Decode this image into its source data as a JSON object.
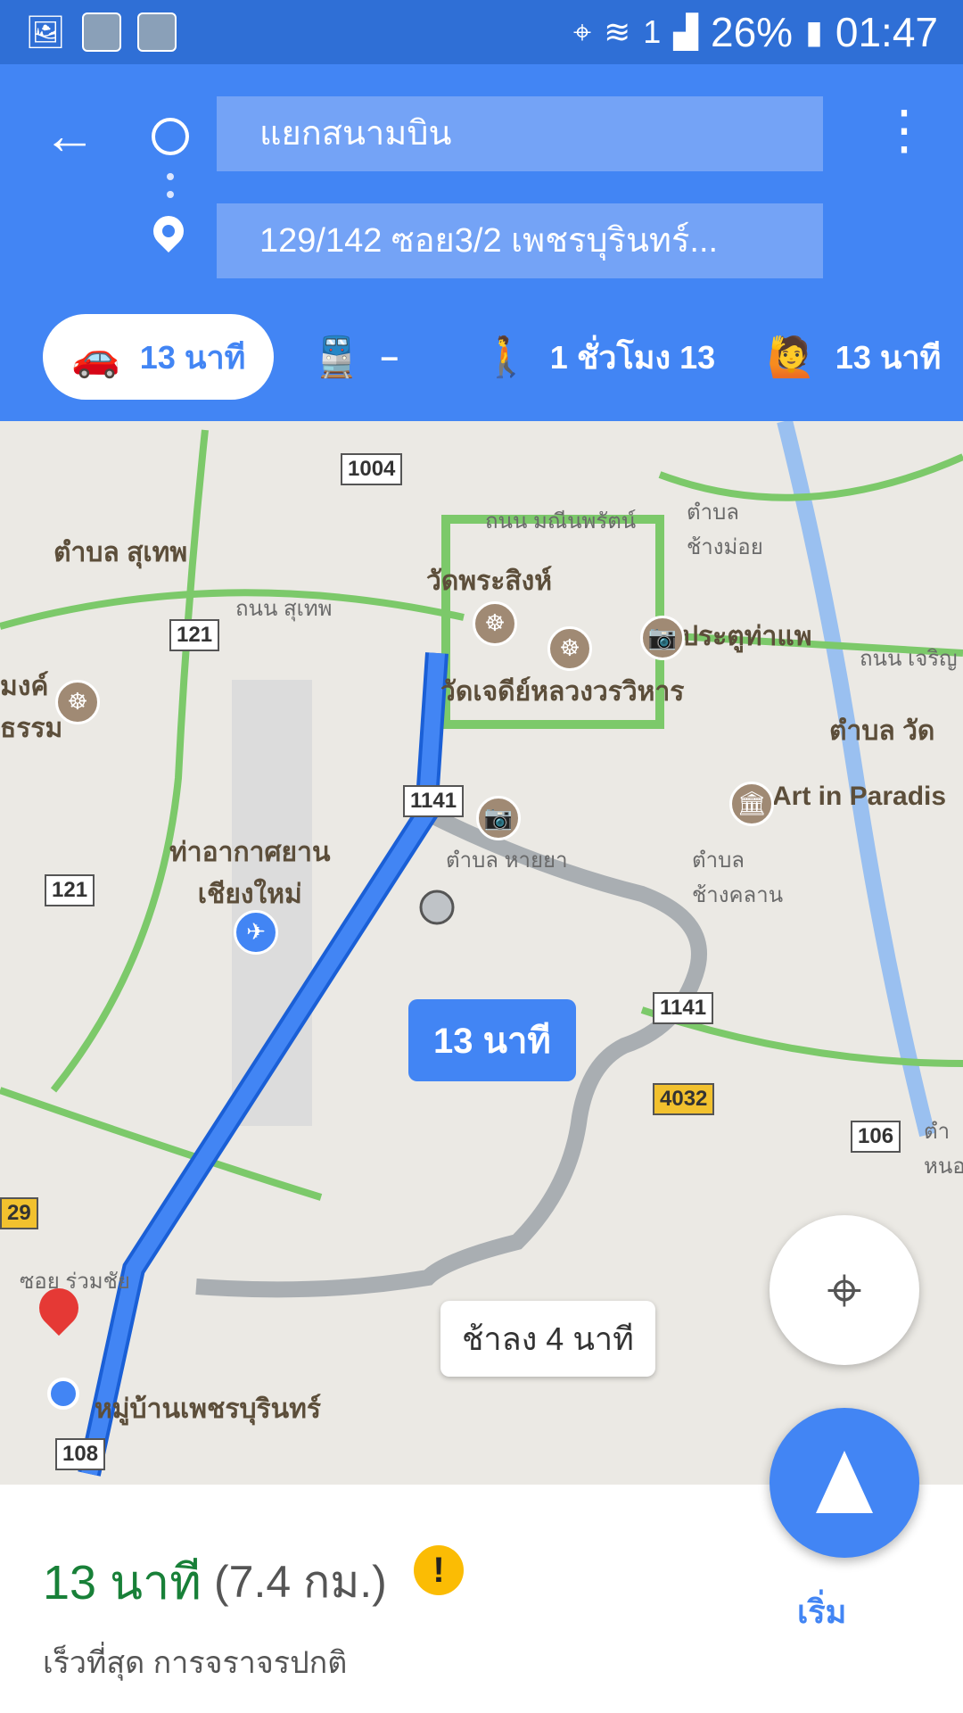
{
  "status_bar": {
    "battery": "26%",
    "time": "01:47",
    "sim": "1"
  },
  "search": {
    "origin": "แยกสนามบิน",
    "destination": "129/142 ซอย3/2 เพชรบุรินทร์..."
  },
  "modes": [
    {
      "name": "drive",
      "label": "13 นาที"
    },
    {
      "name": "transit",
      "label": "–"
    },
    {
      "name": "walk",
      "label": "1 ชั่วโมง 13"
    },
    {
      "name": "ride",
      "label": "13 นาที"
    }
  ],
  "map": {
    "labels": {
      "suthep_district": "ตำบล สุเทพ",
      "wat_phra_singh": "วัดพระสิงห์",
      "wat_chedi_luang": "วัดเจดีย์หลวงวรวิหาร",
      "tha_phae_gate": "ประตูท่าแพ",
      "airport": "ท่าอากาศยาน\nเชียงใหม่",
      "art_in_paradise": "Art in Paradis",
      "mu_ban": "หมู่บ้านเพชรบุรินทร์",
      "changmoi": "ตำบล\nช้างม่อย",
      "changkhlan": "ตำบล\nช้างคลาน",
      "haiya": "ตำบล หายยา",
      "wat_district": "ตำบล วัด",
      "manee_road": "ถนน มณีนพรัตน์",
      "suthep_road": "ถนน สุเทพ",
      "charoenrat_road": "ถนน เจริญ",
      "soi_ruamchai": "ซอย ร่วมชัย",
      "mongkhon": "มงค์\nธรรม",
      "nong_label": "ตำ\nหนอ"
    },
    "shields": {
      "r1004": "1004",
      "r121a": "121",
      "r121b": "121",
      "r1141a": "1141",
      "r1141b": "1141",
      "r4032": "4032",
      "r106": "106",
      "r108": "108",
      "r129": "29"
    },
    "route_time": "13 นาที",
    "alt_route": "ช้าลง 4 นาที"
  },
  "summary": {
    "eta": "13 นาที",
    "distance": "(7.4 กม.)",
    "note": "เร็วที่สุด การจราจรปกติ",
    "warning_symbol": "!"
  },
  "actions": {
    "start_label": "เริ่ม"
  },
  "colors": {
    "brand_blue": "#4285f4",
    "eta_green": "#188038",
    "warning_yellow": "#fbbc04"
  }
}
